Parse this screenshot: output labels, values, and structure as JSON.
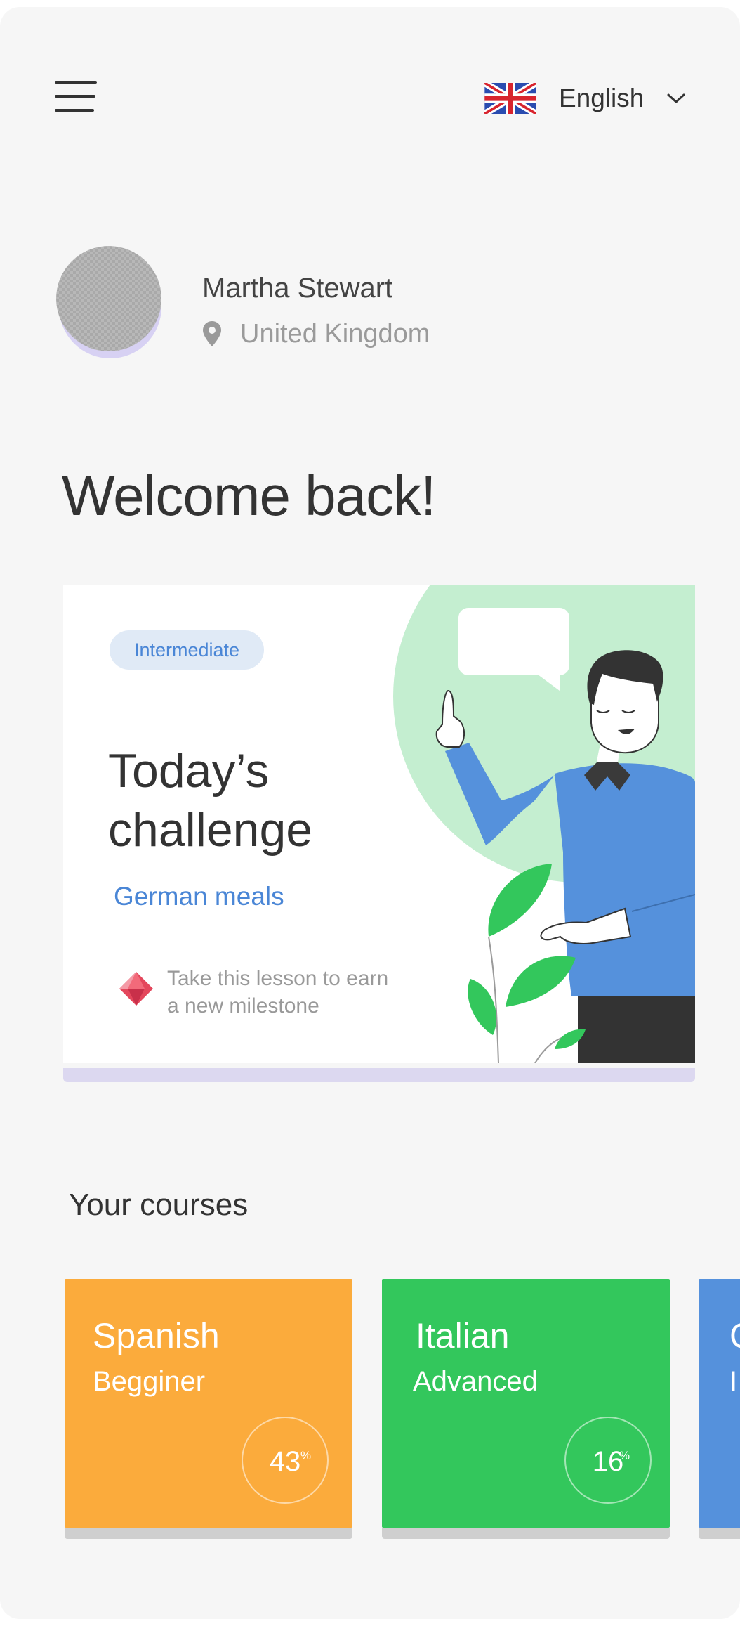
{
  "header": {
    "menu_icon": "hamburger-menu-icon",
    "language": {
      "flag_icon": "uk-flag-icon",
      "label": "English",
      "chevron_icon": "chevron-down-icon"
    }
  },
  "profile": {
    "name": "Martha Stewart",
    "location": "United Kingdom",
    "location_icon": "location-pin-icon"
  },
  "welcome": "Welcome back!",
  "challenge": {
    "badge": "Intermediate",
    "title_line1": "Today’s",
    "title_line2": "challenge",
    "topic": "German meals",
    "milestone_line1": "Take this lesson to earn",
    "milestone_line2": "a new milestone",
    "milestone_icon": "gem-icon"
  },
  "courses": {
    "title": "Your courses",
    "items": [
      {
        "name": "Spanish",
        "level": "Begginer",
        "progress": "43",
        "unit": "%",
        "color": "#fbab3c"
      },
      {
        "name": "Italian",
        "level": "Advanced",
        "progress": "16",
        "unit": "%",
        "color": "#33c75c"
      },
      {
        "name": "G",
        "level": "I",
        "color": "#5591dc"
      }
    ]
  },
  "colors": {
    "accent_blue": "#4a86d6",
    "background": "#f6f6f6",
    "text_dark": "#333333"
  }
}
